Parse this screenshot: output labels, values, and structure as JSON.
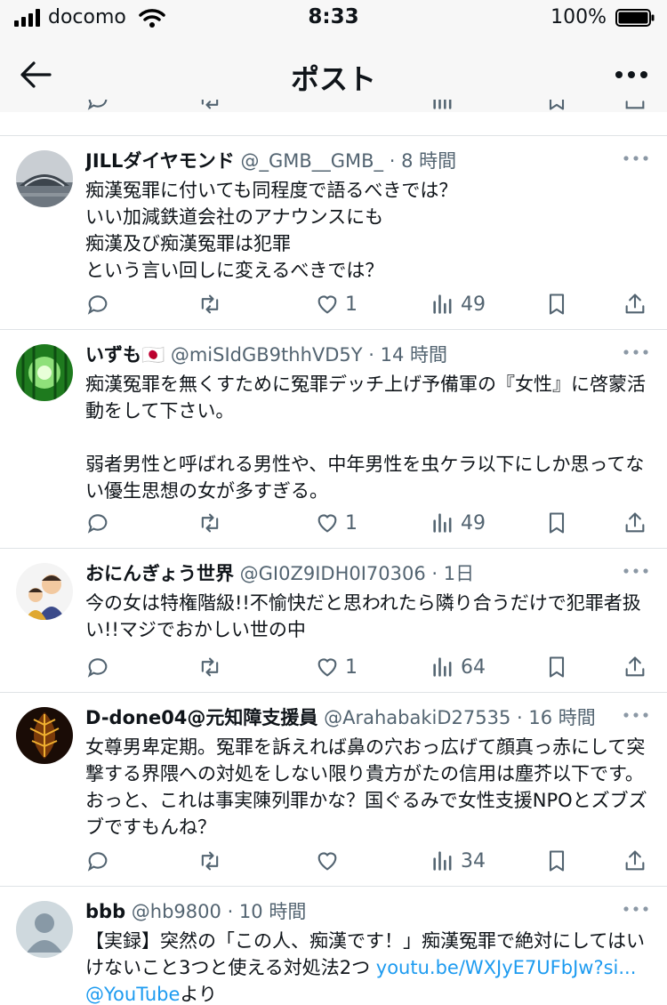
{
  "status_bar": {
    "carrier": "docomo",
    "time": "8:33",
    "battery": "100%"
  },
  "header": {
    "title": "ポスト"
  },
  "colors": {
    "link": "#1d9bf0",
    "meta": "#536471",
    "divider": "#dfe3e6"
  },
  "tweets": [
    {
      "name": "JILLダイヤモンド",
      "handle": "@_GMB__GMB_",
      "time": "· 8 時間",
      "text": "痴漢冤罪に付いても同程度で語るべきでは？\nいい加減鉄道会社のアナウンスにも\n痴漢及び痴漢冤罪は犯罪\nという言い回しに変えるべきでは？",
      "likes": "1",
      "views": "49",
      "avatar_icon": "stadium-photo"
    },
    {
      "name": "いずも🇯🇵",
      "handle": "@miSIdGB9thhVD5Y",
      "time": "· 14 時間",
      "text": "痴漢冤罪を無くすために冤罪デッチ上げ予備軍の『女性』に啓蒙活動をして下さい。\n\n弱者男性と呼ばれる男性や、中年男性を虫ケラ以下にしか思ってない優生思想の女が多すぎる。",
      "likes": "1",
      "views": "49",
      "avatar_icon": "bamboo-forest-photo"
    },
    {
      "name": "おにんぎょう世界",
      "handle": "@GI0Z9IDH0I70306",
      "time": "· 1日",
      "text": "今の女は特権階級!!不愉快だと思われたら隣り合うだけで犯罪者扱い!!マジでおかしい世の中",
      "likes": "1",
      "views": "64",
      "avatar_icon": "illustration-avatar"
    },
    {
      "name": "D-done04@元知障支援員",
      "handle": "@ArahabakiD27535",
      "time": "· 16 時間",
      "text": "女尊男卑定期。冤罪を訴えれば鼻の穴おっ広げて顔真っ赤にして突撃する界隈への対処をしない限り貴方がたの信用は塵芥以下です。おっと、これは事実陳列罪かな？国ぐるみで女性支援NPOとズブズブですもんね？",
      "likes": "",
      "views": "34",
      "avatar_icon": "leaf-photo"
    },
    {
      "name": "bbb",
      "handle": "@hb9800",
      "time": "· 10 時間",
      "text_before": "【実録】突然の「この人、痴漢です！」痴漢冤罪で絶対にしてはいけないこと3つと使える対処法2つ ",
      "link1": "youtu.be/WXJyE7UFbJw?si...",
      "link2": "@YouTube",
      "text_after": "より",
      "avatar_icon": "default-avatar"
    }
  ]
}
